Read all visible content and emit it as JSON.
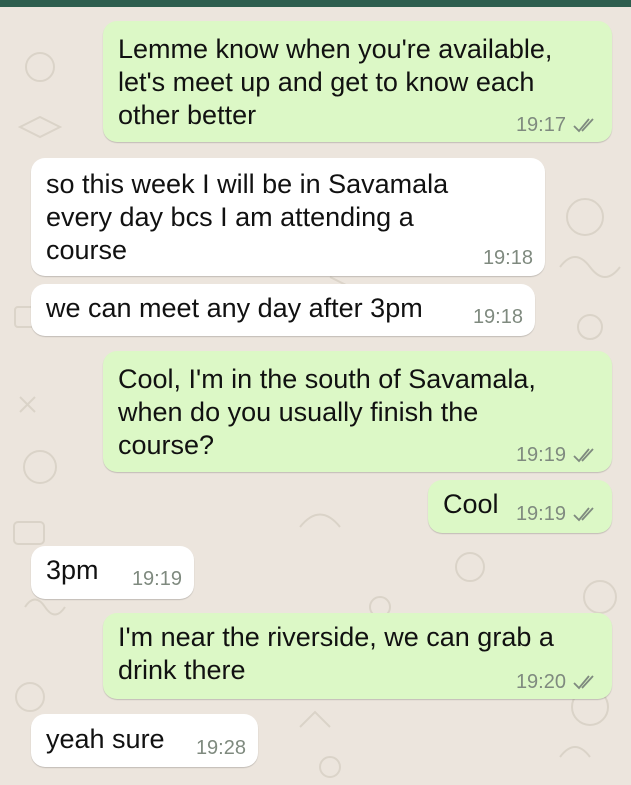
{
  "theme": {
    "wallpaper": "#ECE5DD",
    "bar": "#2E5E4E",
    "outgoing_bubble": "#DCF8C6",
    "incoming_bubble": "#FFFFFF",
    "meta_text": "#7F8A7F"
  },
  "messages": [
    {
      "direction": "outgoing",
      "text": "Lemme know when you're available,\nlet's meet up and get to know each\nother better",
      "time": "19:17",
      "status_icon": "double-check-icon"
    },
    {
      "direction": "incoming",
      "text": "so this week I will be in Savamala\nevery day bcs I am attending a\ncourse",
      "time": "19:18"
    },
    {
      "direction": "incoming",
      "text": "we can meet any day after 3pm",
      "time": "19:18"
    },
    {
      "direction": "outgoing",
      "text": "Cool, I'm in the south of Savamala,\nwhen do you usually finish the\ncourse?",
      "time": "19:19",
      "status_icon": "double-check-icon"
    },
    {
      "direction": "outgoing",
      "text": "Cool",
      "time": "19:19",
      "status_icon": "double-check-icon"
    },
    {
      "direction": "incoming",
      "text": "3pm",
      "time": "19:19"
    },
    {
      "direction": "outgoing",
      "text": "I'm near the riverside, we can grab a\ndrink there",
      "time": "19:20",
      "status_icon": "double-check-icon"
    },
    {
      "direction": "incoming",
      "text": "yeah sure",
      "time": "19:28"
    }
  ]
}
